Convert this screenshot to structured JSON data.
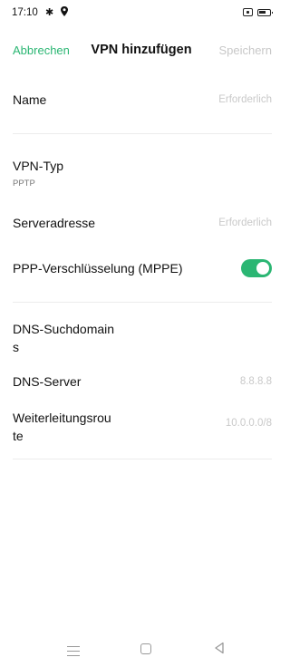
{
  "status_bar": {
    "time": "17:10"
  },
  "title_bar": {
    "cancel_label": "Abbrechen",
    "title": "VPN hinzufügen",
    "save_label": "Speichern"
  },
  "fields": {
    "name": {
      "label": "Name",
      "placeholder": "Erforderlich"
    },
    "vpn_type": {
      "label": "VPN-Typ",
      "value": "PPTP"
    },
    "server": {
      "label": "Serveradresse",
      "placeholder": "Erforderlich"
    },
    "mppe": {
      "label": "PPP-Verschlüsselung (MPPE)",
      "enabled": true
    },
    "dns_search": {
      "label_line1": "DNS-Suchdomain",
      "label_line2": "s"
    },
    "dns_server": {
      "label": "DNS-Server",
      "placeholder": "8.8.8.8"
    },
    "forward_route": {
      "label_line1": "Weiterleitungsrou",
      "label_line2": "te",
      "placeholder": "10.0.0.0/8"
    }
  },
  "colors": {
    "accent": "#2bb673",
    "placeholder": "#c9c9c9",
    "divider": "#ececec"
  },
  "icons": {
    "status": [
      "settings-gear-icon",
      "location-pin-icon",
      "sim-card-icon",
      "battery-icon"
    ],
    "nav": [
      "menu-icon",
      "home-icon",
      "back-icon"
    ]
  }
}
